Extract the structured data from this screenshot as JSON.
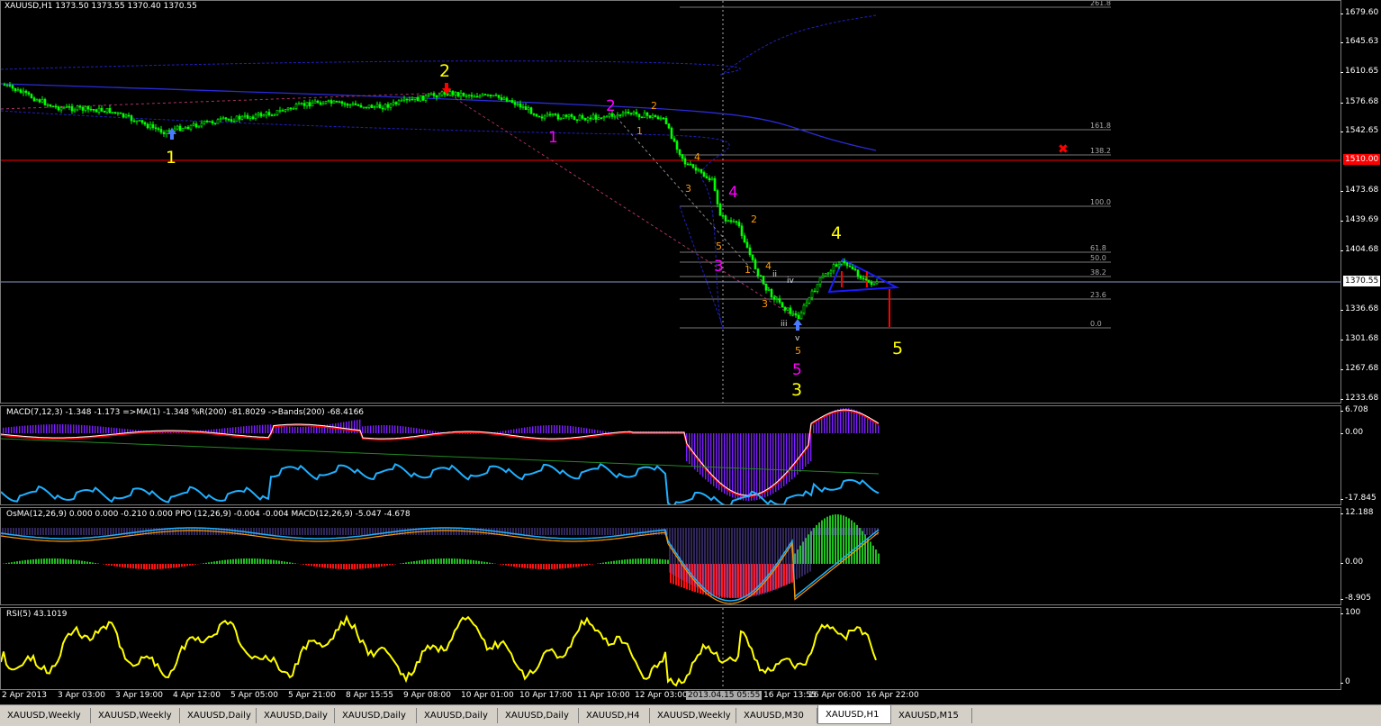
{
  "main": {
    "title": "XAUUSD,H1  1373.50 1373.55 1370.40 1370.55",
    "price_scale": [
      "1679.60",
      "1645.63",
      "1610.65",
      "1576.68",
      "1542.65",
      "1473.68",
      "1439.69",
      "1404.68",
      "1336.68",
      "1301.68",
      "1267.68",
      "1233.68"
    ],
    "line_tags": [
      {
        "text": "1510.00",
        "color": "#ff2a2a"
      },
      {
        "text": "1370.55",
        "color": "#ffffff"
      }
    ],
    "fib_levels": [
      "261.8",
      "161.8",
      "138.2",
      "100.0",
      "61.8",
      "50.0",
      "38.2",
      "23.6",
      "0.0"
    ],
    "wave_labels": {
      "primary": [
        "1",
        "2",
        "3",
        "4",
        "5"
      ],
      "intermediate": [
        "1",
        "2",
        "3",
        "4",
        "5"
      ],
      "minor": [
        "1",
        "2",
        "3",
        "4",
        "5",
        "1",
        "2",
        "3",
        "4",
        "5"
      ],
      "minute": [
        "ii",
        "iii",
        "iv",
        "v"
      ]
    },
    "marker": "✖"
  },
  "macd_panel": {
    "label": "MACD(7,12,3) -1.348 -1.173  =>MA(1) -1.348  %R(200) -81.8029  ->Bands(200) -68.4166",
    "scale": [
      "6.708",
      "0.00",
      "-17.845"
    ]
  },
  "osma_panel": {
    "label": "OsMA(12,26,9) 0.000 0.000 -0.210 0.000  PPO (12,26,9) -0.004 -0.004  MACD(12,26,9) -5.047 -4.678",
    "scale": [
      "12.188",
      "0.00",
      "-8.905"
    ]
  },
  "rsi_panel": {
    "label": "RSI(5) 43.1019",
    "scale": [
      "100",
      "0"
    ]
  },
  "time_axis": [
    "2 Apr 2013",
    "3 Apr 03:00",
    "3 Apr 19:00",
    "4 Apr 12:00",
    "5 Apr 05:00",
    "5 Apr 21:00",
    "8 Apr 15:55",
    "9 Apr 08:00",
    "10 Apr 01:00",
    "10 Apr 17:00",
    "11 Apr 10:00",
    "12 Apr 03:00",
    "2013.04.15 05:55",
    "16 Apr 13:55",
    "16 Apr 06:00",
    "16 Apr 22:00"
  ],
  "tabs": [
    "XAUUSD,Weekly",
    "XAUUSD,Weekly",
    "XAUUSD,Daily",
    "XAUUSD,Daily",
    "XAUUSD,Daily",
    "XAUUSD,Daily",
    "XAUUSD,Daily",
    "XAUUSD,H4",
    "XAUUSD,Weekly",
    "XAUUSD,M30",
    "XAUUSD,H1",
    "XAUUSD,M15"
  ],
  "active_tab_index": 10,
  "colors": {
    "yellow": "#ffff00",
    "magenta": "#ff00ff",
    "orange": "#ff9900",
    "green": "#00ff00",
    "blue": "#1a1aff",
    "red": "#ff0000",
    "cyan": "#20b0ff",
    "macd_hist": "#7b1fff"
  }
}
